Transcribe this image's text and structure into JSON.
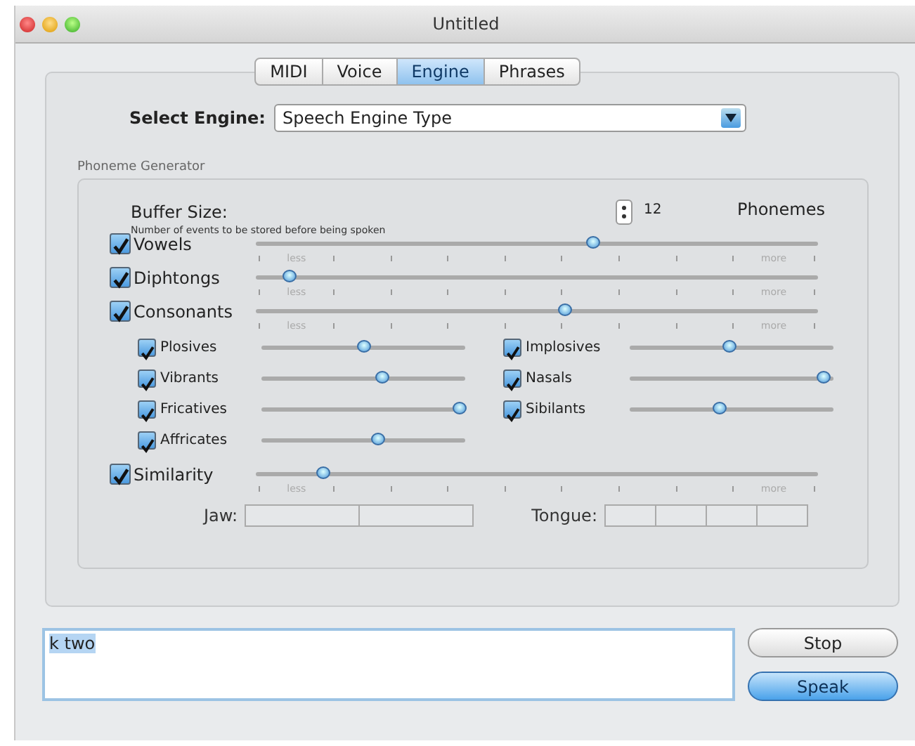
{
  "window": {
    "title": "Untitled"
  },
  "tabs": [
    {
      "label": "MIDI",
      "selected": false
    },
    {
      "label": "Voice",
      "selected": false
    },
    {
      "label": "Engine",
      "selected": true
    },
    {
      "label": "Phrases",
      "selected": false
    }
  ],
  "engine": {
    "label": "Select Engine:",
    "value": "Speech Engine Type"
  },
  "group": {
    "title": "Phoneme Generator",
    "buffer": {
      "label": "Buffer Size:",
      "hint": "Number of events to be stored before being spoken",
      "value": "12",
      "unit": "Phonemes"
    },
    "main_sliders": [
      {
        "label": "Vowels",
        "checked": true,
        "level": 0.6,
        "min_label": "less",
        "max_label": "more"
      },
      {
        "label": "Diphtongs",
        "checked": true,
        "level": 0.06,
        "min_label": "less",
        "max_label": "more"
      },
      {
        "label": "Consonants",
        "checked": true,
        "level": 0.55,
        "min_label": "less",
        "max_label": "more"
      }
    ],
    "sub_sliders": [
      {
        "label": "Plosives",
        "checked": true,
        "level": 0.5
      },
      {
        "label": "Implosives",
        "checked": true,
        "level": 0.49
      },
      {
        "label": "Vibrants",
        "checked": true,
        "level": 0.59
      },
      {
        "label": "Nasals",
        "checked": true,
        "level": 0.95
      },
      {
        "label": "Fricatives",
        "checked": true,
        "level": 0.97
      },
      {
        "label": "Sibilants",
        "checked": true,
        "level": 0.44
      },
      {
        "label": "Affricates",
        "checked": true,
        "level": 0.57
      }
    ],
    "similarity": {
      "label": "Similarity",
      "checked": true,
      "level": 0.12,
      "min_label": "less",
      "max_label": "more"
    },
    "jaw": {
      "label": "Jaw:"
    },
    "tongue": {
      "label": "Tongue:"
    }
  },
  "text_input": {
    "value": "k two",
    "selected": true
  },
  "buttons": [
    {
      "label": "Stop",
      "default": false
    },
    {
      "label": "Speak",
      "default": true
    }
  ]
}
